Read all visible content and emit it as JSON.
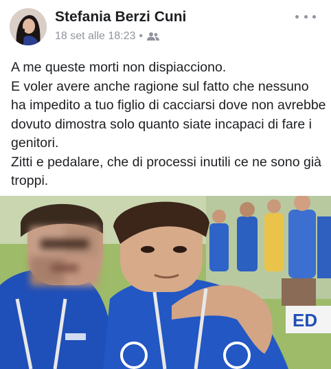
{
  "post": {
    "author_name": "Stefania Berzi Cuni",
    "timestamp": "18 set alle 18:23",
    "separator": "•",
    "audience_icon": "friends-icon",
    "more_icon": "more-options-icon",
    "message_lines": [
      "A me queste morti non dispiacciono.",
      "E voler avere anche ragione sul fatto che nessuno ha impedito a tuo figlio di cacciarsi dove non avrebbe dovuto dimostra solo quanto siate incapaci di fare i genitori.",
      "Zitti e pedalare, che di processi inutili ce ne sono già troppi."
    ],
    "photo_visible_text": "ED"
  },
  "colors": {
    "author": "#1c1e21",
    "meta": "#90949c",
    "jersey_blue": "#1f4fb8",
    "grass": "#8fae5a"
  }
}
